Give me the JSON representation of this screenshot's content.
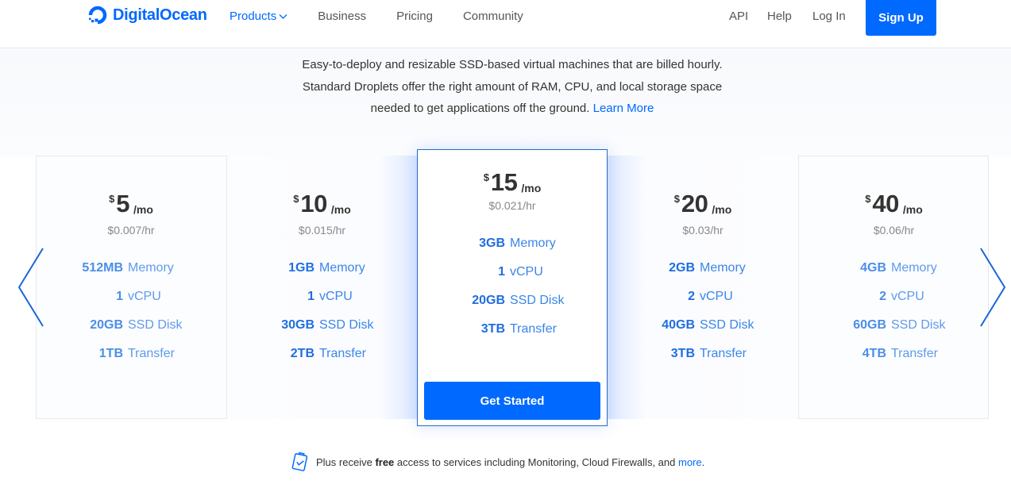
{
  "nav": {
    "brand": "DigitalOcean",
    "links": [
      {
        "label": "Products",
        "active": true,
        "has_dropdown": true
      },
      {
        "label": "Business"
      },
      {
        "label": "Pricing"
      },
      {
        "label": "Community"
      }
    ],
    "right_links": [
      {
        "label": "API"
      },
      {
        "label": "Help"
      },
      {
        "label": "Log In"
      }
    ],
    "signup_label": "Sign Up"
  },
  "hero": {
    "description": "Easy-to-deploy and resizable SSD-based virtual machines that are billed hourly. Standard Droplets offer the right amount of RAM, CPU, and local storage space needed to get applications off the ground.",
    "learn_more": "Learn More"
  },
  "plans": [
    {
      "currency": "$",
      "amount": "5",
      "per": "/mo",
      "hourly": "$0.007/hr",
      "specs": [
        {
          "value": "512MB",
          "label": "Memory"
        },
        {
          "value": "1",
          "label": "vCPU"
        },
        {
          "value": "20GB",
          "label": "SSD Disk"
        },
        {
          "value": "1TB",
          "label": "Transfer"
        }
      ]
    },
    {
      "currency": "$",
      "amount": "10",
      "per": "/mo",
      "hourly": "$0.015/hr",
      "specs": [
        {
          "value": "1GB",
          "label": "Memory"
        },
        {
          "value": "1",
          "label": "vCPU"
        },
        {
          "value": "30GB",
          "label": "SSD Disk"
        },
        {
          "value": "2TB",
          "label": "Transfer"
        }
      ]
    },
    {
      "currency": "$",
      "amount": "15",
      "per": "/mo",
      "hourly": "$0.021/hr",
      "featured": true,
      "specs": [
        {
          "value": "3GB",
          "label": "Memory"
        },
        {
          "value": "1",
          "label": "vCPU"
        },
        {
          "value": "20GB",
          "label": "SSD Disk"
        },
        {
          "value": "3TB",
          "label": "Transfer"
        }
      ],
      "cta": "Get Started"
    },
    {
      "currency": "$",
      "amount": "20",
      "per": "/mo",
      "hourly": "$0.03/hr",
      "specs": [
        {
          "value": "2GB",
          "label": "Memory"
        },
        {
          "value": "2",
          "label": "vCPU"
        },
        {
          "value": "40GB",
          "label": "SSD Disk"
        },
        {
          "value": "3TB",
          "label": "Transfer"
        }
      ]
    },
    {
      "currency": "$",
      "amount": "40",
      "per": "/mo",
      "hourly": "$0.06/hr",
      "specs": [
        {
          "value": "4GB",
          "label": "Memory"
        },
        {
          "value": "2",
          "label": "vCPU"
        },
        {
          "value": "60GB",
          "label": "SSD Disk"
        },
        {
          "value": "4TB",
          "label": "Transfer"
        }
      ]
    }
  ],
  "carousel": {
    "prev_icon": "chevron-left-icon",
    "next_icon": "chevron-right-icon"
  },
  "footer_note": {
    "prefix": "Plus receive",
    "bold": "free",
    "middle": "access to services including Monitoring, Cloud Firewalls, and",
    "link": "more",
    "suffix": ".",
    "icon": "clipboard-check-icon"
  },
  "colors": {
    "brand": "#0069ff",
    "spec_blue": "#1f6ee0",
    "featured_border": "#2b69c4"
  }
}
